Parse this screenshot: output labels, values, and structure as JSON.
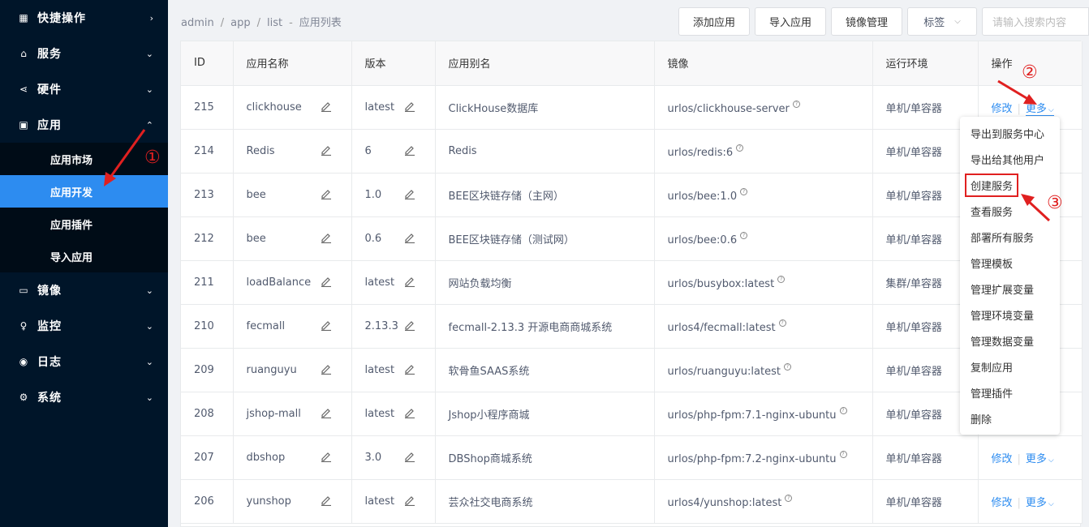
{
  "sidebar": {
    "items": [
      {
        "label": "快捷操作",
        "icon": "grid-icon",
        "chev": "›"
      },
      {
        "label": "服务",
        "icon": "store-icon",
        "chev": "⌄"
      },
      {
        "label": "硬件",
        "icon": "share-icon",
        "chev": "⌄"
      },
      {
        "label": "应用",
        "icon": "apps-icon",
        "chev": "⌃"
      }
    ],
    "sub_items": [
      {
        "label": "应用市场"
      },
      {
        "label": "应用开发"
      },
      {
        "label": "应用插件"
      },
      {
        "label": "导入应用"
      }
    ],
    "items_after": [
      {
        "label": "镜像",
        "icon": "disk-icon",
        "chev": "⌄"
      },
      {
        "label": "监控",
        "icon": "bulb-icon",
        "chev": "⌄"
      },
      {
        "label": "日志",
        "icon": "eye-icon",
        "chev": "⌄"
      },
      {
        "label": "系统",
        "icon": "gear-icon",
        "chev": "⌄"
      }
    ]
  },
  "breadcrumb": {
    "p1": "admin",
    "sep": "/",
    "p2": "app",
    "p3": "list",
    "dash": "-",
    "p4": "应用列表"
  },
  "toolbar": {
    "add": "添加应用",
    "import": "导入应用",
    "mirror": "镜像管理",
    "tag": "标签",
    "search_placeholder": "请输入搜索内容"
  },
  "table": {
    "headers": [
      "ID",
      "应用名称",
      "版本",
      "应用别名",
      "镜像",
      "运行环境",
      "操作"
    ],
    "rows": [
      {
        "id": "215",
        "name": "clickhouse",
        "version": "latest",
        "alias": "ClickHouse数据库",
        "image": "urlos/clickhouse-server",
        "env": "单机/单容器"
      },
      {
        "id": "214",
        "name": "Redis",
        "version": "6",
        "alias": "Redis",
        "image": "urlos/redis:6",
        "env": "单机/单容器"
      },
      {
        "id": "213",
        "name": "bee",
        "version": "1.0",
        "alias": "BEE区块链存储（主网）",
        "image": "urlos/bee:1.0",
        "env": "单机/单容器"
      },
      {
        "id": "212",
        "name": "bee",
        "version": "0.6",
        "alias": "BEE区块链存储（测试网）",
        "image": "urlos/bee:0.6",
        "env": "单机/单容器"
      },
      {
        "id": "211",
        "name": "loadBalance",
        "version": "latest",
        "alias": "网站负载均衡",
        "image": "urlos/busybox:latest",
        "env": "集群/单容器"
      },
      {
        "id": "210",
        "name": "fecmall",
        "version": "2.13.3",
        "alias": "fecmall-2.13.3 开源电商商城系统",
        "image": "urlos4/fecmall:latest",
        "env": "单机/单容器"
      },
      {
        "id": "209",
        "name": "ruanguyu",
        "version": "latest",
        "alias": "软骨鱼SAAS系统",
        "image": "urlos/ruanguyu:latest",
        "env": "单机/单容器"
      },
      {
        "id": "208",
        "name": "jshop-mall",
        "version": "latest",
        "alias": "Jshop小程序商城",
        "image": "urlos/php-fpm:7.1-nginx-ubuntu",
        "env": "单机/单容器"
      },
      {
        "id": "207",
        "name": "dbshop",
        "version": "3.0",
        "alias": "DBShop商城系统",
        "image": "urlos/php-fpm:7.2-nginx-ubuntu",
        "env": "单机/单容器"
      },
      {
        "id": "206",
        "name": "yunshop",
        "version": "latest",
        "alias": "芸众社交电商系统",
        "image": "urlos4/yunshop:latest",
        "env": "单机/单容器"
      }
    ],
    "op_edit": "修改",
    "op_sep": "|",
    "op_more": "更多",
    "help_glyph": "?"
  },
  "dropdown": {
    "items": [
      "导出到服务中心",
      "导出给其他用户",
      "创建服务",
      "查看服务",
      "部署所有服务",
      "管理模板",
      "管理扩展变量",
      "管理环境变量",
      "管理数据变量",
      "复制应用",
      "管理插件",
      "删除"
    ]
  },
  "annotations": {
    "one": "①",
    "two": "②",
    "three": "③"
  },
  "colors": {
    "sidebar_bg": "#001529",
    "active": "#2d8cf0",
    "annotation": "#e02020"
  }
}
